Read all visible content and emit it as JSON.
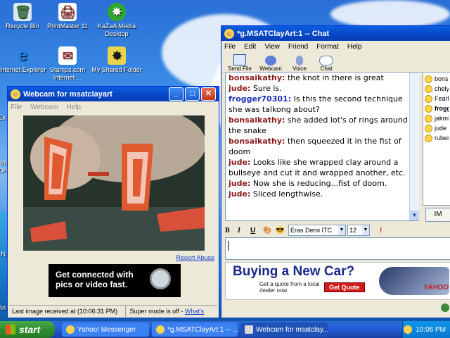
{
  "desktop": {
    "icons": [
      {
        "label": "Recycle Bin",
        "glyph": "🗑",
        "icon": "recycle-bin-icon"
      },
      {
        "label": "PrintMaster 11",
        "glyph": "🖨",
        "icon": "printmaster-icon",
        "badge_top": "PM",
        "badge_num": "11"
      },
      {
        "label": "KaZaA Media Desktop",
        "glyph": "✸",
        "icon": "kazaa-icon"
      },
      {
        "label": "Internet Explorer",
        "glyph": "e",
        "icon": "internet-explorer-icon"
      },
      {
        "label": "Stamps.com Internet ...",
        "glyph": "✉",
        "icon": "stamps-icon"
      },
      {
        "label": "My Shared Folder",
        "glyph": "✸",
        "icon": "shared-folder-icon"
      }
    ],
    "edge_labels": [
      "Ex",
      "In",
      "Or",
      "N",
      "An"
    ]
  },
  "webcam_window": {
    "title": "Webcam for msatclayart",
    "menu": [
      "File",
      "Webcam",
      "Help"
    ],
    "report_abuse": "Report Abuse",
    "ad_text": "Get connected with pics or video fast.",
    "status_left": "Last image received at (10:06:31 PM)",
    "status_right_prefix": "Super mode is off - ",
    "status_right_link": "What's this?"
  },
  "chat_window": {
    "title": "*g.MSATClayArt:1 -- Chat",
    "menu": [
      "File",
      "Edit",
      "View",
      "Friend",
      "Format",
      "Help"
    ],
    "toolbar": [
      {
        "label": "Send File",
        "icon": "send-file-icon"
      },
      {
        "label": "Webcam",
        "icon": "webcam-icon"
      },
      {
        "label": "Voice",
        "icon": "voice-icon"
      },
      {
        "label": "Chat",
        "icon": "chat-icon"
      }
    ],
    "messages": [
      {
        "who": "bonsaikathy:",
        "text": " the knot in there is great",
        "color": "#8a1a1a"
      },
      {
        "who": "jude:",
        "text": " Sure is.",
        "color": "#8a1a1a"
      },
      {
        "who": "frogger70301:",
        "text": " Is this the second technique she was talkong about?",
        "color": "#1a2fb8"
      },
      {
        "who": "bonsaikathy:",
        "text": " she added lot's of rings around the snake",
        "color": "#8a1a1a"
      },
      {
        "who": "bonsaikathy:",
        "text": " then squeezed it in the fist of doom",
        "color": "#8a1a1a"
      },
      {
        "who": "jude:",
        "text": " Looks like she wrapped clay around a bullseye and cut it and wrapped another, etc.",
        "color": "#8a1a1a"
      },
      {
        "who": "jude:",
        "text": " Now she is reducing...fist of doom.",
        "color": "#8a1a1a"
      },
      {
        "who": "jude:",
        "text": " Sliced lengthwise.",
        "color": "#8a1a1a"
      }
    ],
    "buddies": [
      "bonsa",
      "chelyh",
      "Fearle",
      "frogg",
      "jakmia",
      "jude",
      "rubens"
    ],
    "im_button": "IM",
    "format": {
      "bold": "B",
      "italic": "I",
      "underline": "U",
      "font": "Eras Demi ITC",
      "size": "12"
    },
    "ad": {
      "headline": "Buying a New Car?",
      "sub": "Get a quote from a local dealer now.",
      "button": "Get Quote",
      "brand": "YAHOO"
    }
  },
  "taskbar": {
    "start": "start",
    "items": [
      {
        "label": "Yahoo! Messenger"
      },
      {
        "label": "*g.MSATClayArt:1 -- ..."
      },
      {
        "label": "Webcam for msatclay..."
      }
    ],
    "clock": "10:06 PM"
  },
  "colors": {
    "xp_blue": "#0846c4",
    "chat_name_red": "#8a1a1a",
    "chat_name_blue": "#1a2fb8",
    "taskbar": "#245edb",
    "start_green": "#2f8f2f"
  }
}
